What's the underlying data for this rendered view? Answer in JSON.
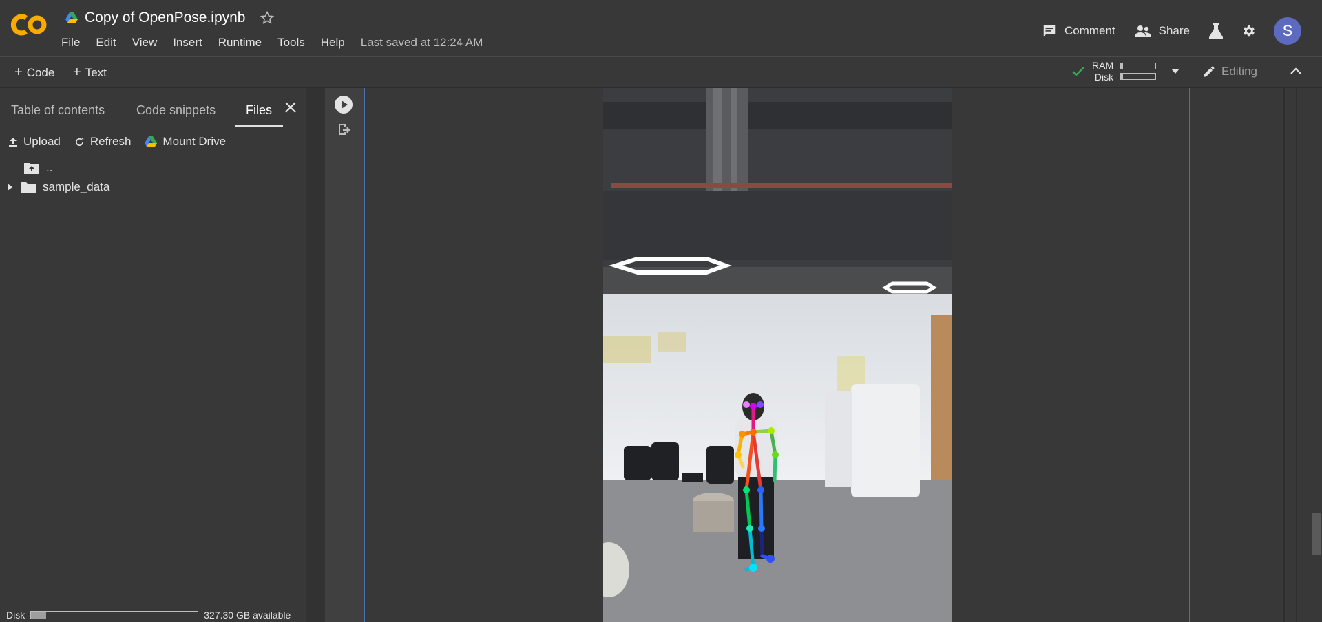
{
  "app": {
    "name": "Google Colab",
    "logo_text": "CO",
    "notebook_title": "Copy of OpenPose.ipynb",
    "last_saved": "Last saved at 12:24 AM",
    "menu": [
      "File",
      "Edit",
      "View",
      "Insert",
      "Runtime",
      "Tools",
      "Help"
    ]
  },
  "header_actions": {
    "comment_label": "Comment",
    "share_label": "Share",
    "avatar_letter": "S"
  },
  "toolbar": {
    "code_label": "Code",
    "text_label": "Text",
    "ram_label": "RAM",
    "disk_label": "Disk",
    "ram_usage": 0.06,
    "disk_usage": 0.06,
    "editing_label": "Editing"
  },
  "sidebar": {
    "tabs": [
      "Table of contents",
      "Code snippets",
      "Files"
    ],
    "active_tab": "Files",
    "actions": {
      "upload": "Upload",
      "refresh": "Refresh",
      "mount_drive": "Mount Drive"
    },
    "files": [
      {
        "name": "..",
        "type": "parent-folder"
      },
      {
        "name": "sample_data",
        "type": "folder"
      }
    ],
    "footer": {
      "disk_label": "Disk",
      "available": "327.30 GB available",
      "disk_usage": 0.09
    }
  },
  "colors": {
    "accent_orange": "#f9ab00",
    "accent_blue": "#4d6fb0",
    "avatar": "#5c6bc0",
    "ok_green": "#34a853"
  },
  "icons": [
    "drive-icon",
    "star-icon",
    "comment-icon",
    "share-people-icon",
    "flask-icon",
    "gear-icon",
    "plus-icon",
    "checkmark-icon",
    "pencil-icon",
    "chevron-up-icon",
    "close-icon",
    "upload-icon",
    "refresh-icon",
    "folder-icon",
    "play-icon",
    "output-icon"
  ]
}
